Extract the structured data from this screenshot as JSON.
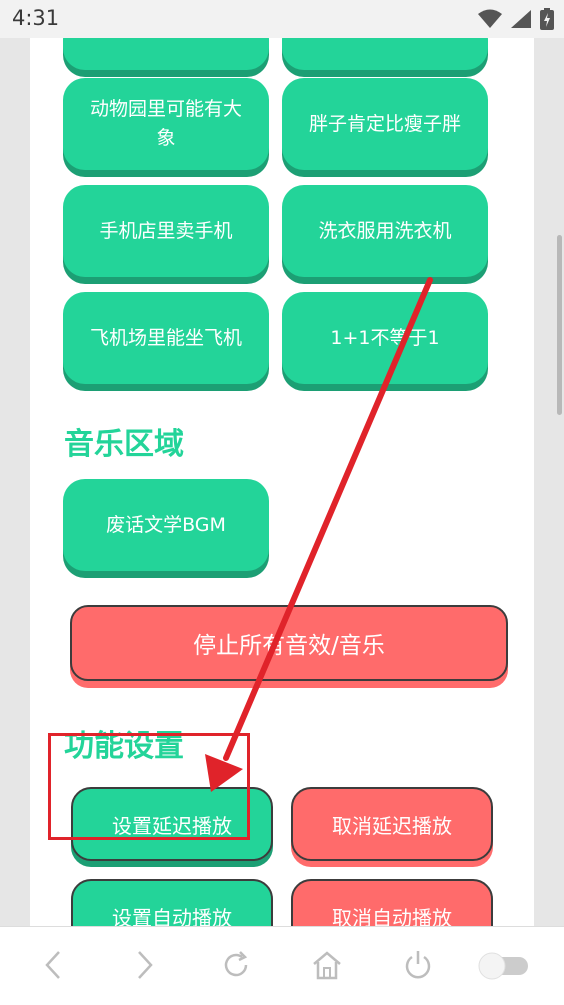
{
  "status_bar": {
    "time": "4:31"
  },
  "clip_buttons": [
    {
      "label": ""
    },
    {
      "label": ""
    },
    {
      "label": "动物园里可能有大象"
    },
    {
      "label": "胖子肯定比瘦子胖"
    },
    {
      "label": "手机店里卖手机"
    },
    {
      "label": "洗衣服用洗衣机"
    },
    {
      "label": "飞机场里能坐飞机"
    },
    {
      "label": "1+1不等于1"
    }
  ],
  "music_section": {
    "title": "音乐区域",
    "buttons": [
      {
        "label": "废话文学BGM"
      }
    ]
  },
  "stop_all_label": "停止所有音效/音乐",
  "function_section": {
    "title": "功能设置",
    "set_delay_label": "设置延迟播放",
    "cancel_delay_label": "取消延迟播放",
    "set_auto_label": "设置自动播放",
    "cancel_auto_label": "取消自动播放"
  },
  "colors": {
    "accent_green": "#23d499",
    "green_shadow": "#1c9f74",
    "alert_red": "#ff6b6b",
    "annotation_red": "#e0232a"
  },
  "nav_icons": [
    "back-icon",
    "forward-icon",
    "refresh-icon",
    "home-icon",
    "power-icon",
    "toggle-switch"
  ]
}
